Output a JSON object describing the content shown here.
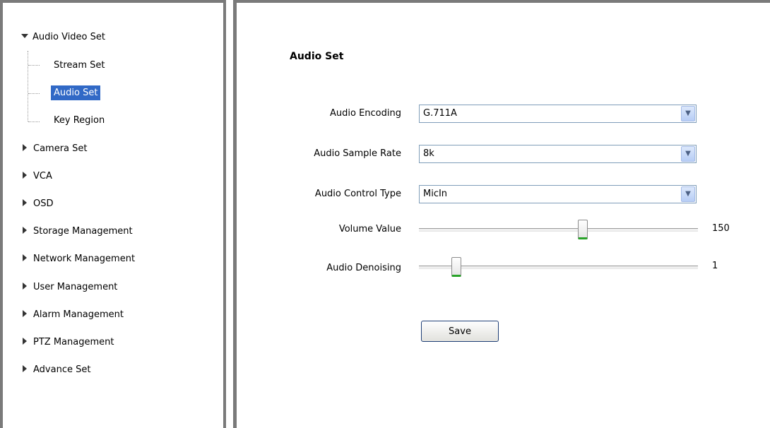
{
  "sidebar": {
    "items": [
      {
        "label": "Audio Video Set",
        "expanded": true,
        "children": [
          {
            "label": "Stream Set",
            "selected": false
          },
          {
            "label": "Audio Set",
            "selected": true
          },
          {
            "label": "Key Region",
            "selected": false
          }
        ]
      },
      {
        "label": "Camera Set",
        "expanded": false
      },
      {
        "label": "VCA",
        "expanded": false
      },
      {
        "label": "OSD",
        "expanded": false
      },
      {
        "label": "Storage Management",
        "expanded": false
      },
      {
        "label": "Network Management",
        "expanded": false
      },
      {
        "label": "User Management",
        "expanded": false
      },
      {
        "label": "Alarm Management",
        "expanded": false
      },
      {
        "label": "PTZ Management",
        "expanded": false
      },
      {
        "label": "Advance Set",
        "expanded": false
      }
    ]
  },
  "main": {
    "title": "Audio Set",
    "fields": {
      "audio_encoding": {
        "label": "Audio Encoding",
        "value": "G.711A"
      },
      "audio_sample_rate": {
        "label": "Audio Sample Rate",
        "value": "8k"
      },
      "audio_control_type": {
        "label": "Audio Control Type",
        "value": "MicIn"
      },
      "volume_value": {
        "label": "Volume Value",
        "value": "150",
        "level_fraction": 0.59
      },
      "audio_denoising": {
        "label": "Audio Denoising",
        "value": "1",
        "level_fraction": 0.12
      }
    },
    "save_label": "Save"
  },
  "colors": {
    "selection": "#3169c6",
    "frame": "#7a7a7a",
    "thumb_accent": "#29a329"
  }
}
